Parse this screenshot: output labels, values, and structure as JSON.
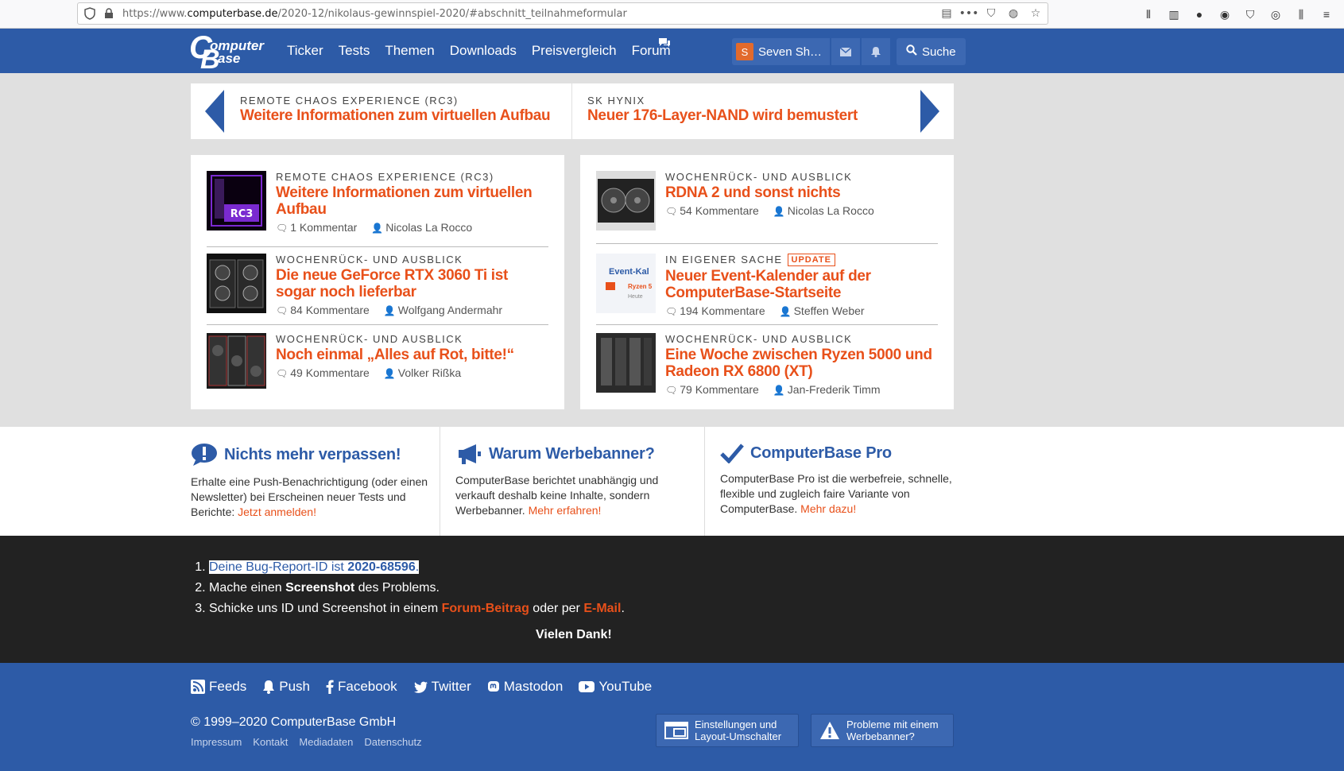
{
  "browser": {
    "url_prefix": "https://www.",
    "url_domain": "computerbase.de",
    "url_path": "/2020-12/nikolaus-gewinnspiel-2020/#abschnitt_teilnahmeformular"
  },
  "header": {
    "logo_line1": "omputer",
    "logo_line2": "ase",
    "nav": [
      "Ticker",
      "Tests",
      "Themen",
      "Downloads",
      "Preisvergleich",
      "Forum"
    ],
    "user_initial": "S",
    "user_name": "Seven Sh…",
    "search_label": "Suche"
  },
  "slider": [
    {
      "kicker": "Remote Chaos Experience (RC3)",
      "title": "Weitere Informationen zum virtuellen Aufbau"
    },
    {
      "kicker": "SK Hynix",
      "title": "Neuer 176-Layer-NAND wird bemustert"
    }
  ],
  "articles_left": [
    {
      "kicker": "Remote Chaos Experience (RC3)",
      "title": "Weitere Informationen zum virtuellen Aufbau",
      "comments": "1 Kommentar",
      "author": "Nicolas La Rocco"
    },
    {
      "kicker": "Wochenrück- und Ausblick",
      "title": "Die neue GeForce RTX 3060 Ti ist sogar noch lieferbar",
      "comments": "84 Kommentare",
      "author": "Wolfgang Andermahr"
    },
    {
      "kicker": "Wochenrück- und Ausblick",
      "title": "Noch einmal „Alles auf Rot, bitte!“",
      "comments": "49 Kommentare",
      "author": "Volker Rißka"
    }
  ],
  "articles_right": [
    {
      "kicker": "Wochenrück- und Ausblick",
      "title": "RDNA 2 und sonst nichts",
      "comments": "54 Kommentare",
      "author": "Nicolas La Rocco"
    },
    {
      "kicker": "In eigener Sache",
      "badge": "Update",
      "title": "Neuer Event-Kalender auf der ComputerBase-Startseite",
      "comments": "194 Kommentare",
      "author": "Steffen Weber"
    },
    {
      "kicker": "Wochenrück- und Ausblick",
      "title": "Eine Woche zwischen Ryzen 5000 und Radeon RX 6800 (XT)",
      "comments": "79 Kommentare",
      "author": "Jan-Frederik Timm"
    }
  ],
  "thumb_text": {
    "rc3": "RC3",
    "event1": "Event-Kal",
    "event2": "Ryzen 5",
    "event3": "Heute"
  },
  "infoboxes": [
    {
      "title": "Nichts mehr verpassen!",
      "text": "Erhalte eine Push-Benachrichtigung (oder einen Newsletter) bei Erscheinen neuer Tests und Berichte: ",
      "link": "Jetzt anmelden!"
    },
    {
      "title": "Warum Werbebanner?",
      "text": "ComputerBase berichtet unabhängig und verkauft deshalb keine Inhalte, sondern Werbebanner. ",
      "link": "Mehr erfahren!"
    },
    {
      "title": "ComputerBase Pro",
      "text": "ComputerBase Pro ist die werbefreie, schnelle, flexible und zugleich faire Variante von ComputerBase. ",
      "link": "Mehr dazu!"
    }
  ],
  "bugreport": {
    "step1_prefix": "Deine Bug-Report-ID ist ",
    "step1_id": "2020-68596",
    "step1_suffix": ".",
    "step2_prefix": "Mache einen ",
    "step2_bold": "Screenshot",
    "step2_suffix": " des Problems.",
    "step3_prefix": "Schicke uns ID und Screenshot in einem ",
    "step3_link1": "Forum-Beitrag",
    "step3_mid": " oder per ",
    "step3_link2": "E-Mail",
    "step3_suffix": ".",
    "thanks": "Vielen Dank!"
  },
  "footer": {
    "social": [
      "Feeds",
      "Push",
      "Facebook",
      "Twitter",
      "Mastodon",
      "YouTube"
    ],
    "copyright": "© 1999–2020 ComputerBase GmbH",
    "links": [
      "Impressum",
      "Kontakt",
      "Mediadaten",
      "Datenschutz"
    ],
    "btn_settings_l1": "Einstellungen und",
    "btn_settings_l2": "Layout-Umschalter",
    "btn_problems_l1": "Probleme mit einem",
    "btn_problems_l2": "Werbebanner?"
  },
  "colors": {
    "brand_blue": "#2d5ba7",
    "accent_orange": "#e8501a",
    "dark_band": "#222222"
  }
}
